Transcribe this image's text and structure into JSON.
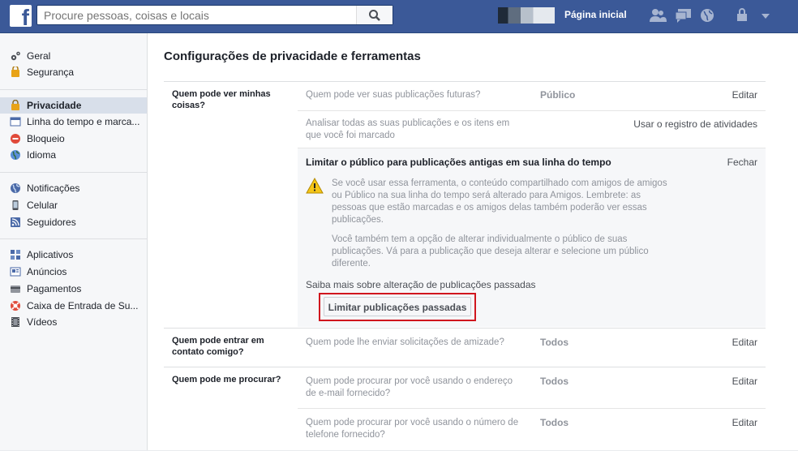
{
  "header": {
    "logo_letter": "f",
    "search_placeholder": "Procure pessoas, coisas e locais",
    "home_label": "Página inicial"
  },
  "sidebar": {
    "groups": [
      [
        {
          "label": "Geral",
          "icon": "gear-icon"
        },
        {
          "label": "Segurança",
          "icon": "security-badge-icon"
        }
      ],
      [
        {
          "label": "Privacidade",
          "icon": "lock-icon",
          "active": true
        },
        {
          "label": "Linha do tempo e marca...",
          "icon": "timeline-icon"
        },
        {
          "label": "Bloqueio",
          "icon": "block-icon"
        },
        {
          "label": "Idioma",
          "icon": "globe-icon"
        }
      ],
      [
        {
          "label": "Notificações",
          "icon": "notifications-globe-icon"
        },
        {
          "label": "Celular",
          "icon": "mobile-icon"
        },
        {
          "label": "Seguidores",
          "icon": "rss-icon"
        }
      ],
      [
        {
          "label": "Aplicativos",
          "icon": "apps-icon"
        },
        {
          "label": "Anúncios",
          "icon": "ads-icon"
        },
        {
          "label": "Pagamentos",
          "icon": "card-icon"
        },
        {
          "label": "Caixa de Entrada de Su...",
          "icon": "lifebuoy-icon"
        },
        {
          "label": "Vídeos",
          "icon": "film-icon"
        }
      ]
    ]
  },
  "main": {
    "title": "Configurações de privacidade e ferramentas",
    "sections": [
      {
        "heading": "Quem pode ver minhas coisas?",
        "rows": [
          {
            "question": "Quem pode ver suas publicações futuras?",
            "value": "Público",
            "action": "Editar"
          },
          {
            "question": "Analisar todas as suas publicações e os itens em que você foi marcado",
            "value": "",
            "action": "Usar o registro de atividades"
          }
        ],
        "expanded": {
          "title": "Limitar o público para publicações antigas em sua linha do tempo",
          "close": "Fechar",
          "warning": "Se você usar essa ferramenta, o conteúdo compartilhado com amigos de amigos ou Público na sua linha do tempo será alterado para Amigos. Lembrete: as pessoas que estão marcadas e os amigos delas também poderão ver essas publicações.",
          "info": "Você também tem a opção de alterar individualmente o público de suas publicações. Vá para a publicação que deseja alterar e selecione um público diferente.",
          "learn_more": "Saiba mais sobre alteração de publicações passadas",
          "button": "Limitar publicações passadas"
        }
      },
      {
        "heading": "Quem pode entrar em contato comigo?",
        "rows": [
          {
            "question": "Quem pode lhe enviar solicitações de amizade?",
            "value": "Todos",
            "action": "Editar"
          }
        ]
      },
      {
        "heading": "Quem pode me procurar?",
        "rows": [
          {
            "question": "Quem pode procurar por você usando o endereço de e-mail fornecido?",
            "value": "Todos",
            "action": "Editar"
          },
          {
            "question": "Quem pode procurar por você usando o número de telefone fornecido?",
            "value": "Todos",
            "action": "Editar"
          }
        ]
      }
    ]
  },
  "colors": {
    "brand": "#3b5998",
    "highlight": "#d0161e",
    "warning": "#f5c518"
  }
}
